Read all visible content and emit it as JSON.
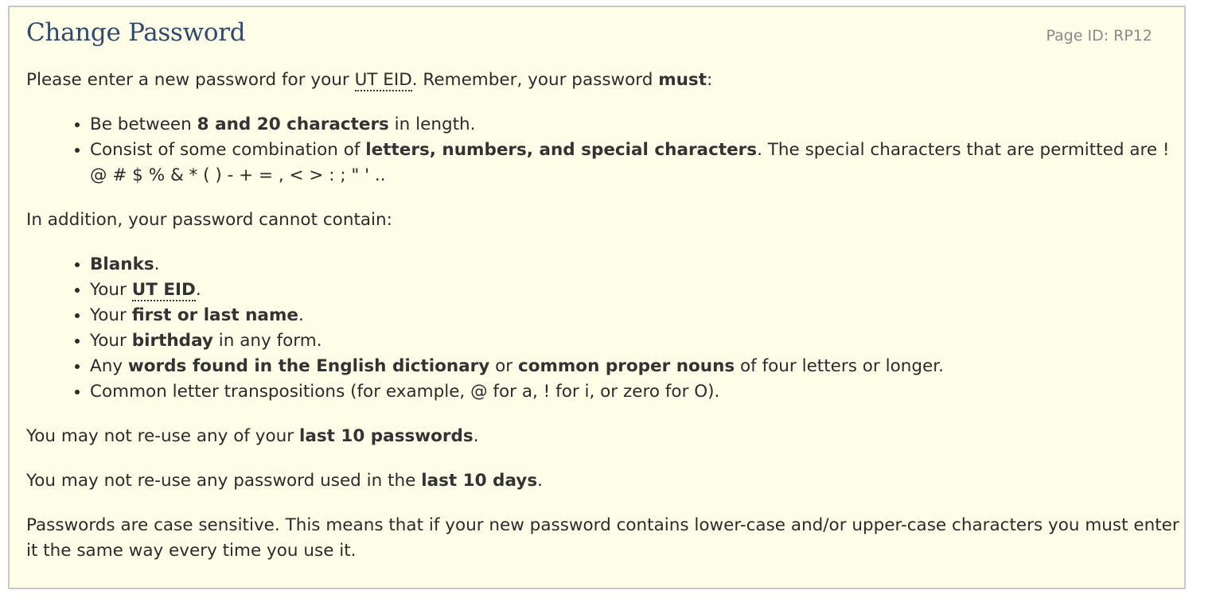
{
  "title": "Change Password",
  "page_id": "Page ID: RP12",
  "intro": {
    "text1": "Please enter a new password for your ",
    "abbr": "UT EID",
    "text2": ". Remember, your password ",
    "bold": "must",
    "text3": ":"
  },
  "rules": {
    "length": {
      "pre": "Be between ",
      "bold": "8 and 20 characters",
      "post": " in length."
    },
    "combination": {
      "pre": "Consist of some combination of ",
      "bold": "letters, numbers, and special characters",
      "post": ". The special characters that are permitted are ! @ # $ % & * ( ) - + = , < > : ; \" ' .."
    }
  },
  "addition_text": "In addition, your password cannot contain:",
  "restrictions": {
    "blanks": {
      "bold": "Blanks",
      "post": "."
    },
    "eid": {
      "pre": "Your ",
      "bold": "UT EID",
      "post": "."
    },
    "name": {
      "pre": "Your ",
      "bold": "first or last name",
      "post": "."
    },
    "birthday": {
      "pre": "Your ",
      "bold": "birthday",
      "post": " in any form."
    },
    "words": {
      "pre": "Any ",
      "bold1": "words found in the English dictionary",
      "mid": " or ",
      "bold2": "common proper nouns",
      "post": " of four letters or longer."
    },
    "transpositions": "Common letter transpositions (for example, @ for a, ! for i, or zero for O)."
  },
  "reuse_passwords": {
    "pre": "You may not re-use any of your ",
    "bold": "last 10 passwords",
    "post": "."
  },
  "reuse_days": {
    "pre": "You may not re-use any password used in the ",
    "bold": "last 10 days",
    "post": "."
  },
  "case_sensitive": "Passwords are case sensitive. This means that if your new password contains lower-case and/or upper-case characters you must enter it the same way every time you use it."
}
